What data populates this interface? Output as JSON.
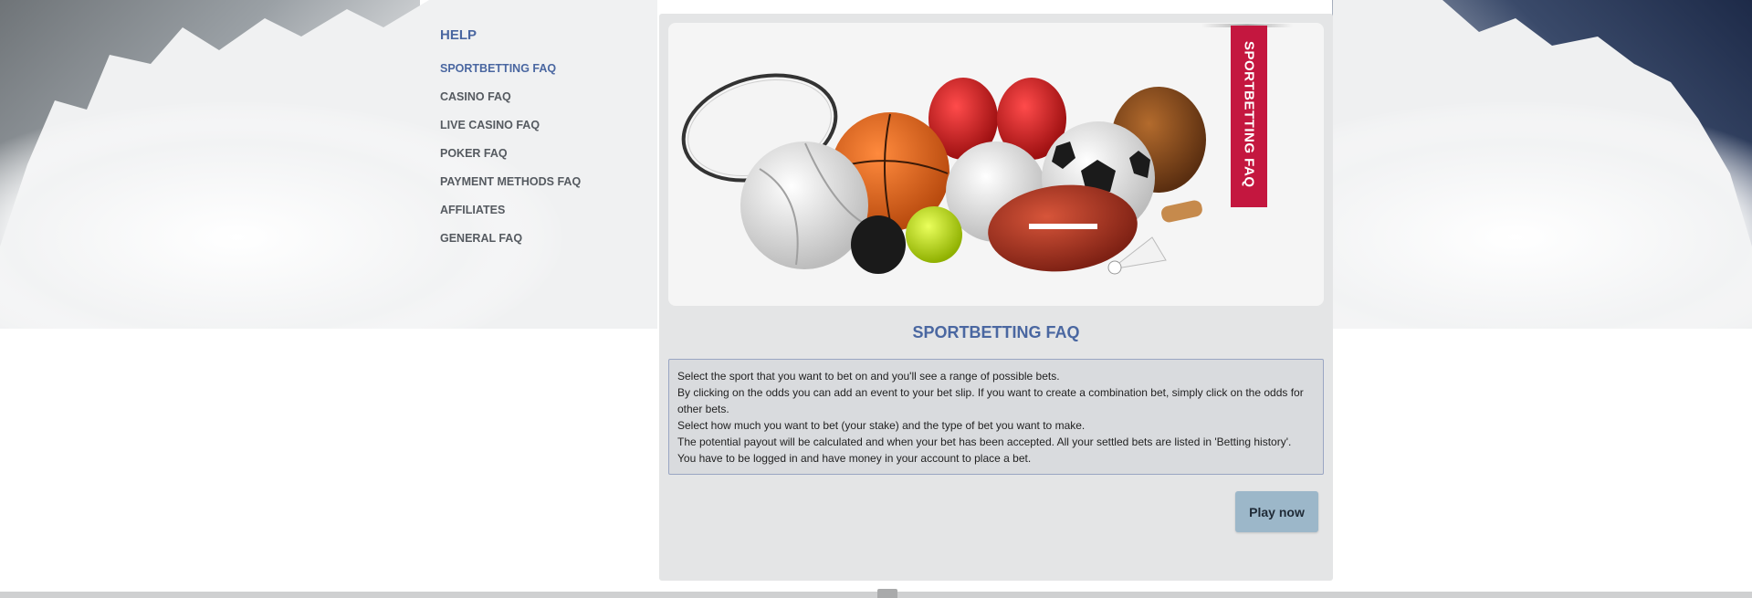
{
  "sidebar": {
    "heading": "HELP",
    "items": [
      {
        "label": "SPORTBETTING FAQ",
        "active": true
      },
      {
        "label": "CASINO FAQ",
        "active": false
      },
      {
        "label": "LIVE CASINO FAQ",
        "active": false
      },
      {
        "label": "POKER FAQ",
        "active": false
      },
      {
        "label": "PAYMENT METHODS FAQ",
        "active": false
      },
      {
        "label": "AFFILIATES",
        "active": false
      },
      {
        "label": "GENERAL FAQ",
        "active": false
      }
    ]
  },
  "hero": {
    "ribbon_label": "SPORTBETTING FAQ",
    "image": "sports-balls-equipment"
  },
  "main": {
    "title": "SPORTBETTING FAQ",
    "faq_lines": [
      "Select the sport that you want to bet on and you'll see a range of possible bets.",
      "By clicking on the odds you can add an event to your bet slip. If you want to create a combination bet, simply click on the odds for other bets.",
      "Select how much you want to bet (your stake) and the type of bet you want to make.",
      "The potential payout will be calculated and when your bet has been accepted. All your settled bets are listed in 'Betting history'.",
      "You have to be logged in and have money in your account to place a bet."
    ],
    "play_button": "Play now"
  },
  "colors": {
    "accent_blue": "#4a67a1",
    "ribbon_red": "#c4173f",
    "button_blue": "#9cb7c9",
    "panel_gray": "#e4e5e6"
  }
}
